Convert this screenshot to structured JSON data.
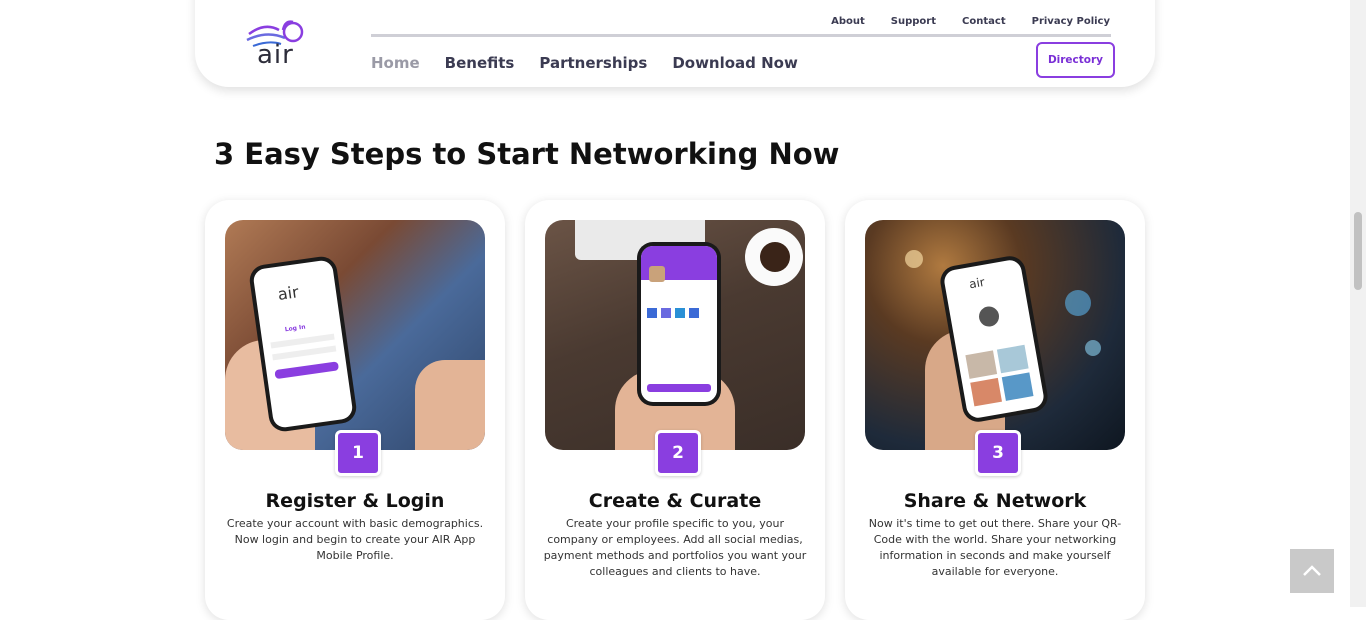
{
  "header": {
    "logo_text": "air",
    "top_links": [
      "About",
      "Support",
      "Contact",
      "Privacy Policy"
    ],
    "main_nav": [
      "Home",
      "Benefits",
      "Partnerships",
      "Download Now"
    ],
    "directory_label": "Directory"
  },
  "section": {
    "heading": "3 Easy Steps to Start Networking Now",
    "steps": [
      {
        "number": "1",
        "title": "Register & Login",
        "description": "Create your account with basic demographics. Now login and begin to create your AIR App Mobile Profile."
      },
      {
        "number": "2",
        "title": "Create & Curate",
        "description": "Create your profile specific to you, your company or employees. Add all social medias, payment methods and portfolios you want your colleagues and clients to have."
      },
      {
        "number": "3",
        "title": "Share & Network",
        "description": "Now it's time to get out there. Share your QR-Code with the world. Share your networking information in seconds and make yourself available for everyone."
      }
    ]
  },
  "colors": {
    "accent": "#8a3ee0",
    "text": "#3b3b52"
  }
}
